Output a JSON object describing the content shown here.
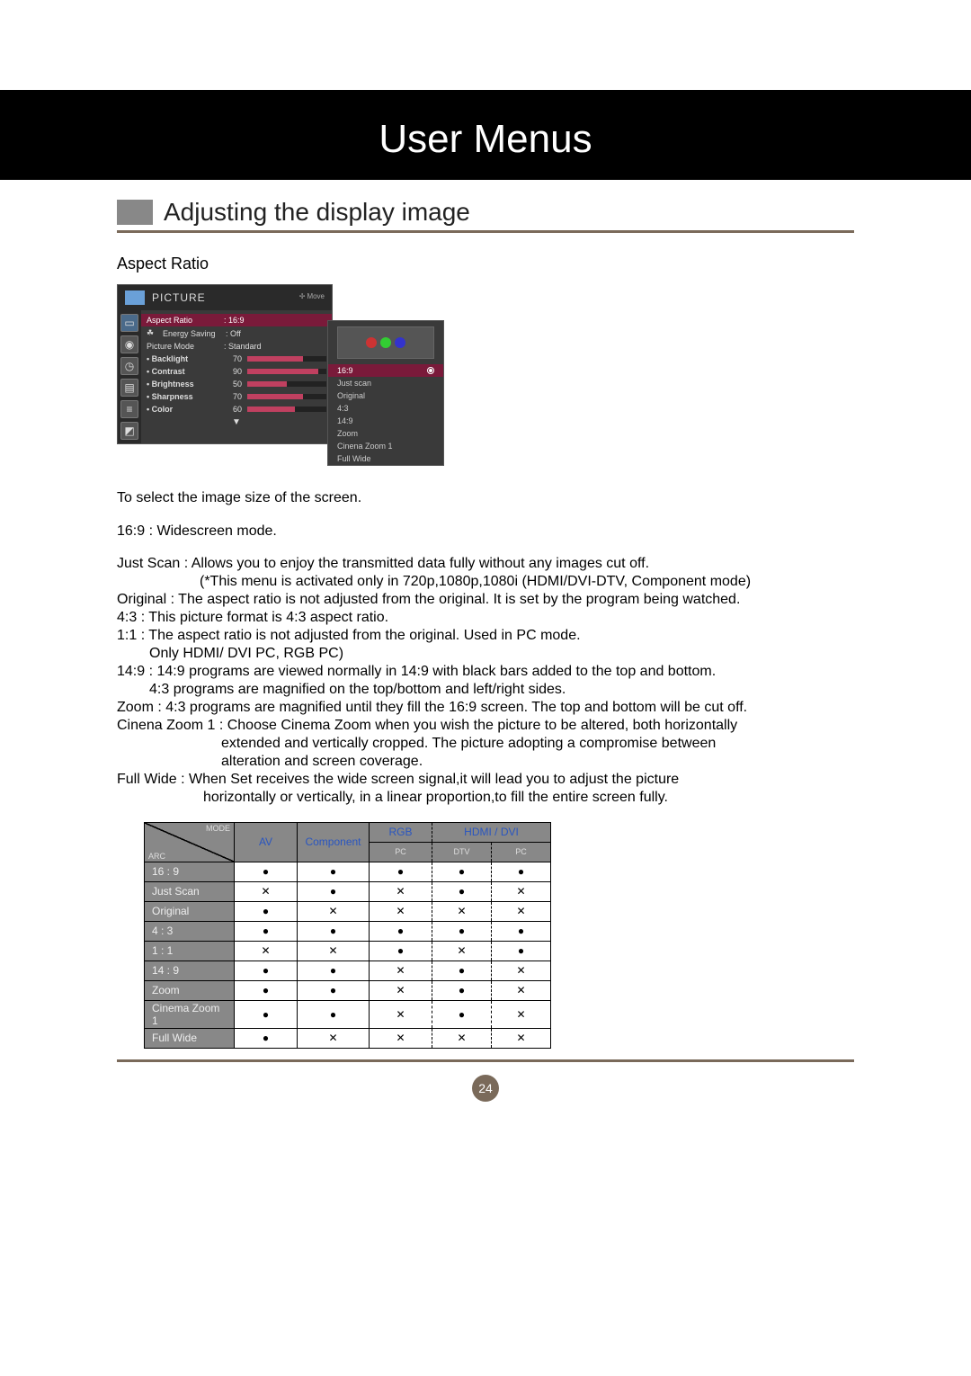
{
  "title": "User Menus",
  "subtitle": "Adjusting the display image",
  "aspect_ratio_label": "Aspect Ratio",
  "osd": {
    "title": "PICTURE",
    "move_label": "Move",
    "items": [
      {
        "label": "Aspect Ratio",
        "value": ": 16:9",
        "highlight": true,
        "slider": false
      },
      {
        "label": "Energy Saving",
        "value": ": Off",
        "highlight": false,
        "slider": false,
        "icon": "leaf"
      },
      {
        "label": "Picture Mode",
        "value": ": Standard",
        "highlight": false,
        "slider": false
      }
    ],
    "sliders": [
      {
        "label": "• Backlight",
        "value": 70
      },
      {
        "label": "• Contrast",
        "value": 90
      },
      {
        "label": "• Brightness",
        "value": 50
      },
      {
        "label": "• Sharpness",
        "value": 70
      },
      {
        "label": "• Color",
        "value": 60
      }
    ],
    "more": "▼"
  },
  "popup": {
    "selected": "16:9",
    "options": [
      "16:9",
      "Just scan",
      "Original",
      "4:3",
      "14:9",
      "Zoom",
      "Cinena Zoom 1",
      "Full Wide"
    ]
  },
  "intro": "To select the image size of the screen.",
  "descriptions": [
    "16:9 :  Widescreen mode.",
    "Just Scan :  Allows you to enjoy the transmitted data fully without any images cut off.",
    "(*This menu is activated only in 720p,1080p,1080i (HDMI/DVI-DTV, Component mode)",
    "Original :  The aspect ratio is not adjusted from the original. It is set by the program being watched.",
    "4:3 :  This picture format is 4:3 aspect ratio.",
    "1:1 :  The aspect ratio is not adjusted from the original. Used in PC mode.",
    "Only HDMI/ DVI PC, RGB PC)",
    "14:9 :  14:9 programs are viewed normally in 14:9 with black bars added to the top and bottom.",
    "4:3 programs are magnified on the top/bottom and left/right sides.",
    "Zoom :  4:3 programs are magnified until they fill the 16:9 screen. The top and bottom will be cut off.",
    "Cinena Zoom 1 :  Choose Cinema Zoom when you wish the picture to be altered, both horizontally",
    "extended and vertically cropped. The picture adopting a compromise between",
    "alteration and screen coverage.",
    "Full Wide :  When Set receives the wide screen signal,it will lead you to adjust the picture",
    "horizontally or vertically, in a linear proportion,to fill the entire screen fully."
  ],
  "table": {
    "header_mode": "MODE",
    "header_arc": "ARC",
    "cols_top": [
      "AV",
      "Component",
      "RGB",
      "HDMI / DVI"
    ],
    "cols_sub": [
      "",
      "",
      "PC",
      "DTV",
      "PC"
    ],
    "row_labels": [
      "16 : 9",
      "Just Scan",
      "Original",
      "4 : 3",
      "1 : 1",
      "14 : 9",
      "Zoom",
      "Cinema Zoom 1",
      "Full Wide"
    ],
    "cells": [
      [
        "●",
        "●",
        "●",
        "●",
        "●"
      ],
      [
        "✕",
        "●",
        "✕",
        "●",
        "✕"
      ],
      [
        "●",
        "✕",
        "✕",
        "✕",
        "✕"
      ],
      [
        "●",
        "●",
        "●",
        "●",
        "●"
      ],
      [
        "✕",
        "✕",
        "●",
        "✕",
        "●"
      ],
      [
        "●",
        "●",
        "✕",
        "●",
        "✕"
      ],
      [
        "●",
        "●",
        "✕",
        "●",
        "✕"
      ],
      [
        "●",
        "●",
        "✕",
        "●",
        "✕"
      ],
      [
        "●",
        "✕",
        "✕",
        "✕",
        "✕"
      ]
    ]
  },
  "page_number": "24"
}
